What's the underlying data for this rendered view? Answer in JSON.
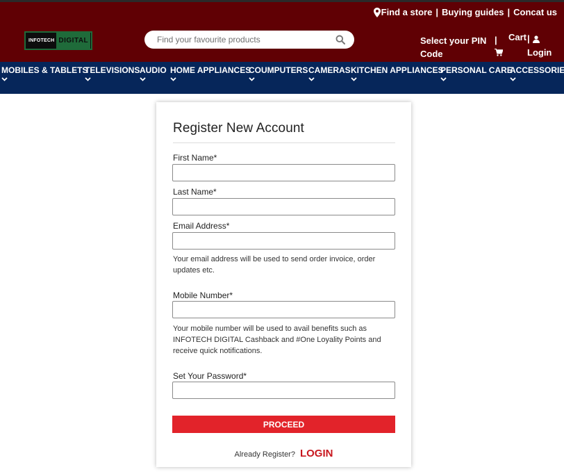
{
  "header": {
    "find_store": "Find a store",
    "sep": "|",
    "buying_guides": "Buying guides",
    "contact": "Concat us",
    "logo_left": "INFOTECH",
    "logo_right": "DIGITAL",
    "search_placeholder": "Find your favourite products",
    "pin_line1": "Select your PIN",
    "pin_line2": "Code",
    "pipe": "|",
    "cart": "Cart",
    "login": "Login",
    "colors": {
      "top_bg": "#600004",
      "nav_bg": "#06265a"
    }
  },
  "nav": {
    "items": [
      {
        "label": "MOBILES & TABLETS"
      },
      {
        "label": "TELEVISIONS"
      },
      {
        "label": "AUDIO"
      },
      {
        "label": "HOME APPLIANCES"
      },
      {
        "label": "COUMPUTERS"
      },
      {
        "label": "CAMERAS"
      },
      {
        "label": "KITCHEN APPLIANCES"
      },
      {
        "label": "PERSONAL CARE"
      },
      {
        "label": "ACCESSORIES"
      }
    ]
  },
  "form": {
    "title": "Register New Account",
    "first_name_label": "First Name*",
    "last_name_label": "Last Name*",
    "email_label": "Email Address*",
    "email_help": "Your email address will be used to send order invoice, order updates etc.",
    "mobile_label": "Mobile Number*",
    "mobile_help": "Your mobile number will be used to avail benefits such as INFOTECH DIGITAL Cashback and #One Loyality Points and receive quick notifications.",
    "password_label": "Set Your Password*",
    "proceed": "PROCEED",
    "already": "Already Register?",
    "login": "LOGIN",
    "colors": {
      "proceed_bg": "#e2232a",
      "login_text": "#c8171e"
    }
  }
}
